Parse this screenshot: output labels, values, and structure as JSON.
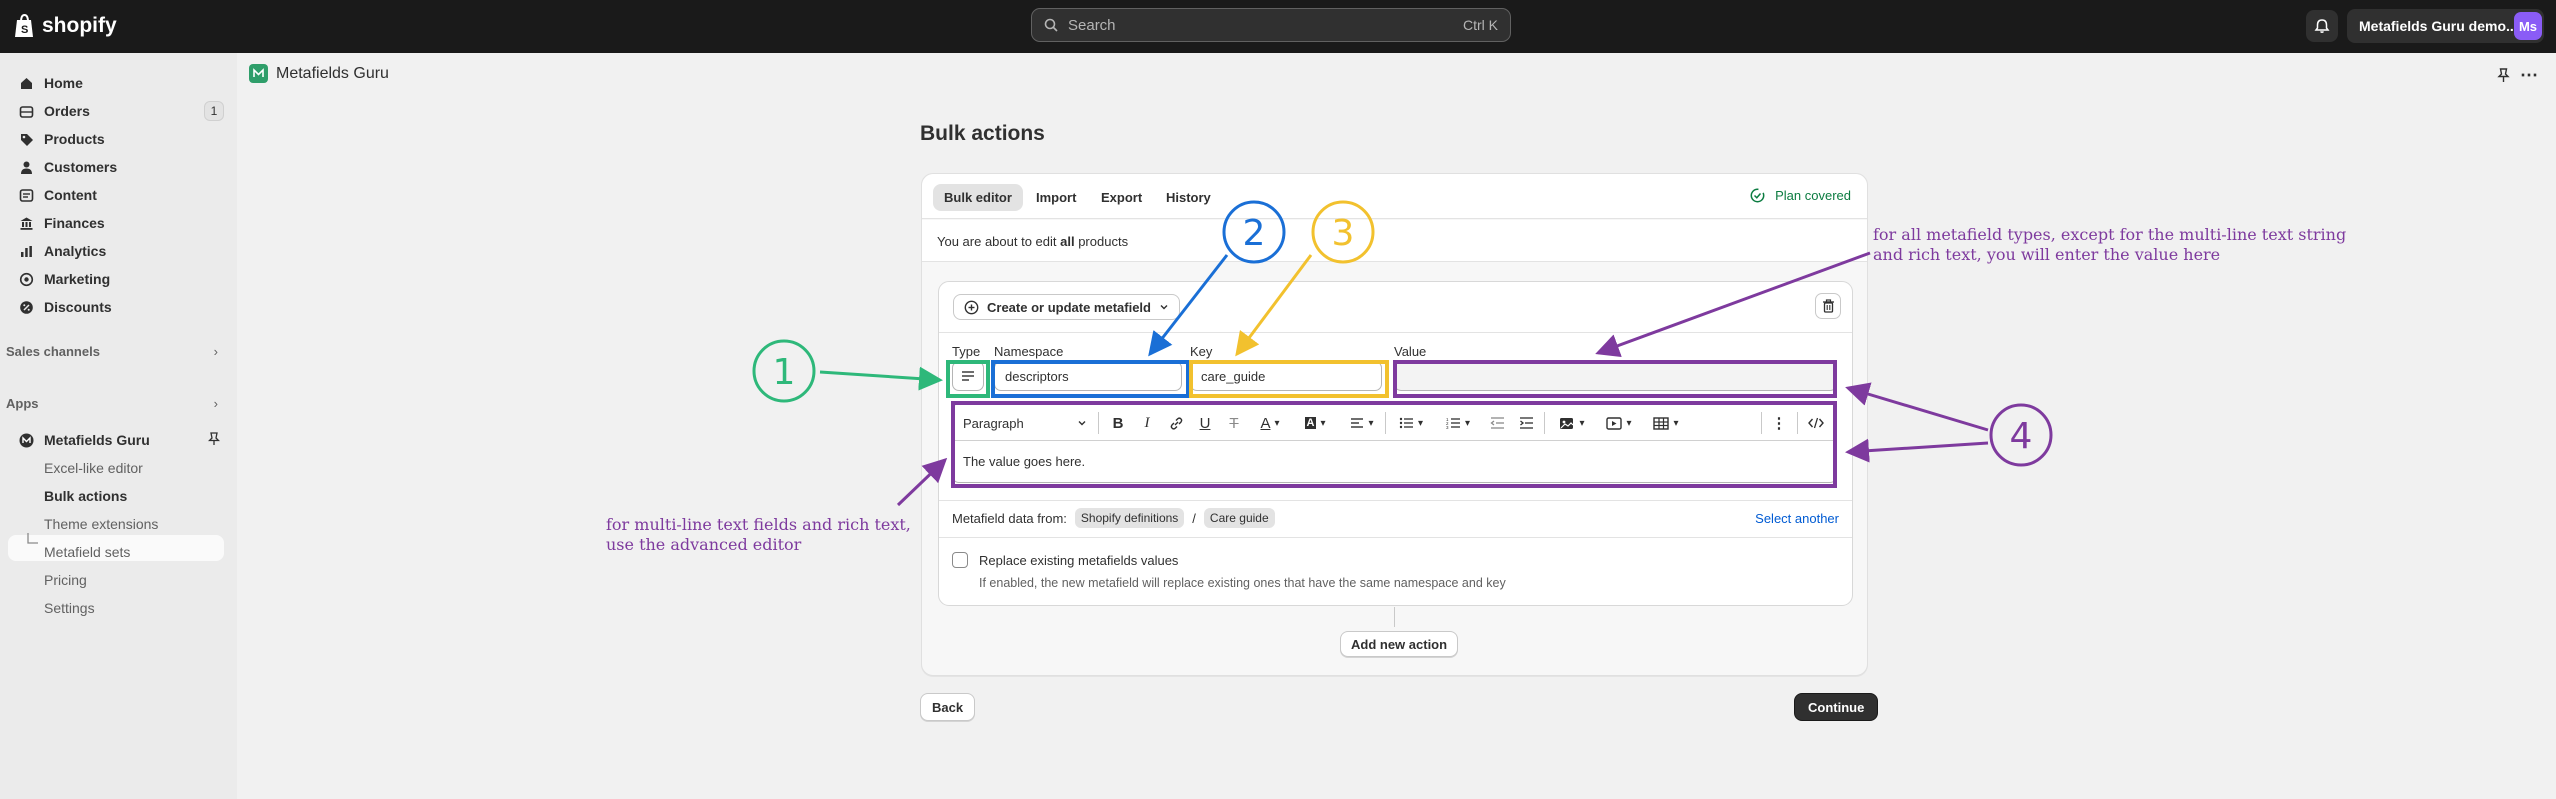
{
  "topbar": {
    "brand": "shopify",
    "search_placeholder": "Search",
    "search_shortcut": "Ctrl K",
    "store_name": "Metafields Guru demo...",
    "avatar_initials": "Ms"
  },
  "sidebar": {
    "items": [
      {
        "label": "Home",
        "icon": "home-icon"
      },
      {
        "label": "Orders",
        "icon": "orders-icon",
        "badge": "1"
      },
      {
        "label": "Products",
        "icon": "tag-icon"
      },
      {
        "label": "Customers",
        "icon": "person-icon"
      },
      {
        "label": "Content",
        "icon": "content-icon"
      },
      {
        "label": "Finances",
        "icon": "bank-icon"
      },
      {
        "label": "Analytics",
        "icon": "chart-icon"
      },
      {
        "label": "Marketing",
        "icon": "target-icon"
      },
      {
        "label": "Discounts",
        "icon": "discount-icon"
      }
    ],
    "sales_channels": "Sales channels",
    "apps": "Apps",
    "app_name": "Metafields Guru",
    "app_subitems": [
      "Excel-like editor",
      "Bulk actions",
      "Theme extensions",
      "Metafield sets",
      "Pricing",
      "Settings"
    ]
  },
  "apphead": {
    "title": "Metafields Guru"
  },
  "page": {
    "title": "Bulk actions",
    "tabs": [
      "Bulk editor",
      "Import",
      "Export",
      "History"
    ],
    "plan_status": "Plan covered",
    "edit_prefix": "You are about to edit ",
    "edit_bold": "all",
    "edit_suffix": " products",
    "create_button": "Create or update metafield",
    "labels": {
      "type": "Type",
      "namespace": "Namespace",
      "key": "Key",
      "value": "Value"
    },
    "namespace_value": "descriptors",
    "key_value": "care_guide",
    "editor_block": "Paragraph",
    "editor_text": "The value goes here.",
    "metafield_from_label": "Metafield data from:",
    "chip_definitions": "Shopify definitions",
    "chip_sep": "/",
    "chip_guide": "Care guide",
    "select_another": "Select another",
    "replace_label": "Replace existing metafields values",
    "replace_help": "If enabled, the new metafield will replace existing ones that have the same namespace and key",
    "add_action": "Add new action",
    "back": "Back",
    "continue": "Continue"
  },
  "annotations": {
    "n1": "1",
    "n2": "2",
    "n3": "3",
    "n4": "4",
    "note_value_1": "for all metafield types, except for the multi-line text string",
    "note_value_2": "and rich text, you will enter the value here",
    "note_editor_1": "for multi-line text fields and rich text,",
    "note_editor_2": "use the advanced editor",
    "colors": {
      "green": "#2eb87a",
      "blue": "#1a6fd6",
      "yellow": "#f2c12e",
      "purple": "#7e3a9e"
    }
  }
}
